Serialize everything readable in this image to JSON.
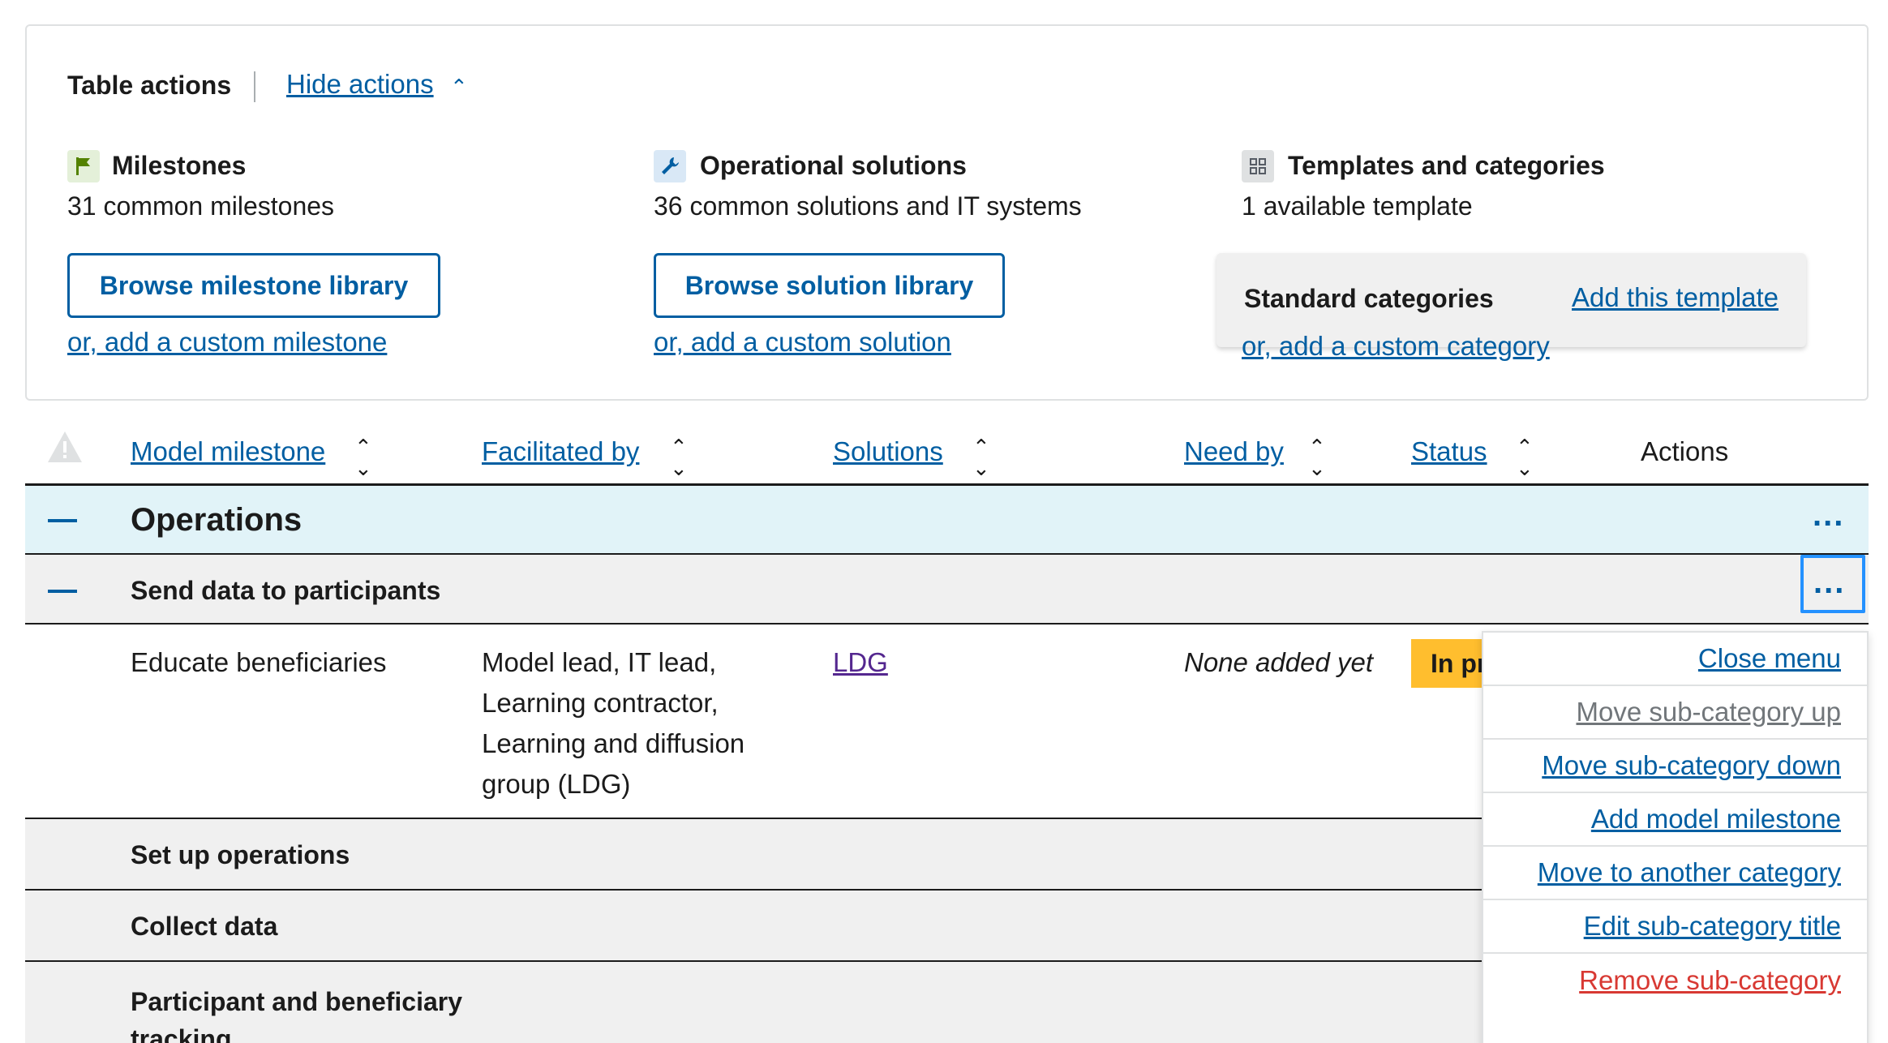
{
  "table_actions": {
    "title": "Table actions",
    "hide_label": "Hide actions",
    "columns": [
      {
        "title": "Milestones",
        "subtitle": "31 common milestones",
        "button_label": "Browse milestone library",
        "custom_link": "or, add a custom milestone",
        "icon": "flag-icon"
      },
      {
        "title": "Operational solutions",
        "subtitle": "36 common solutions and IT systems",
        "button_label": "Browse solution library",
        "custom_link": "or, add a custom solution",
        "icon": "wrench-icon"
      },
      {
        "title": "Templates and categories",
        "subtitle": "1 available template",
        "template_name": "Standard categories",
        "template_add": "Add this template",
        "custom_link": "or, add a custom category",
        "icon": "grid-icon"
      }
    ]
  },
  "table": {
    "headers": [
      "Model milestone",
      "Facilitated by",
      "Solutions",
      "Need by",
      "Status",
      "Actions"
    ],
    "category": "Operations",
    "subcategory": "Send data to participants",
    "milestone_row": {
      "name": "Educate beneficiaries",
      "facilitated_by_lines": [
        "Model lead, IT lead,",
        "Learning contractor,",
        "Learning and diffusion",
        "group (LDG)"
      ],
      "solution": "LDG",
      "need_by": "None added yet",
      "status": "In progress"
    },
    "other_subcategories": [
      "Set up operations",
      "Collect data",
      "Participant and beneficiary tracking"
    ],
    "actions_glyph": "..."
  },
  "menu": {
    "items": [
      {
        "label": "Close menu",
        "state": "normal"
      },
      {
        "label": "Move sub-category up",
        "state": "disabled"
      },
      {
        "label": "Move sub-category down",
        "state": "normal"
      },
      {
        "label": "Add model milestone",
        "state": "normal"
      },
      {
        "label": "Move to another category",
        "state": "normal"
      },
      {
        "label": "Edit sub-category title",
        "state": "normal"
      },
      {
        "label": "Remove sub-category",
        "state": "danger"
      }
    ]
  },
  "colors": {
    "link": "#005ea2",
    "category_bg": "#e1f3f8",
    "subcategory_bg": "#f0f0f0",
    "status_in_progress": "#ffbe2e",
    "danger": "#d83933",
    "focus_outline": "#2491ff"
  }
}
